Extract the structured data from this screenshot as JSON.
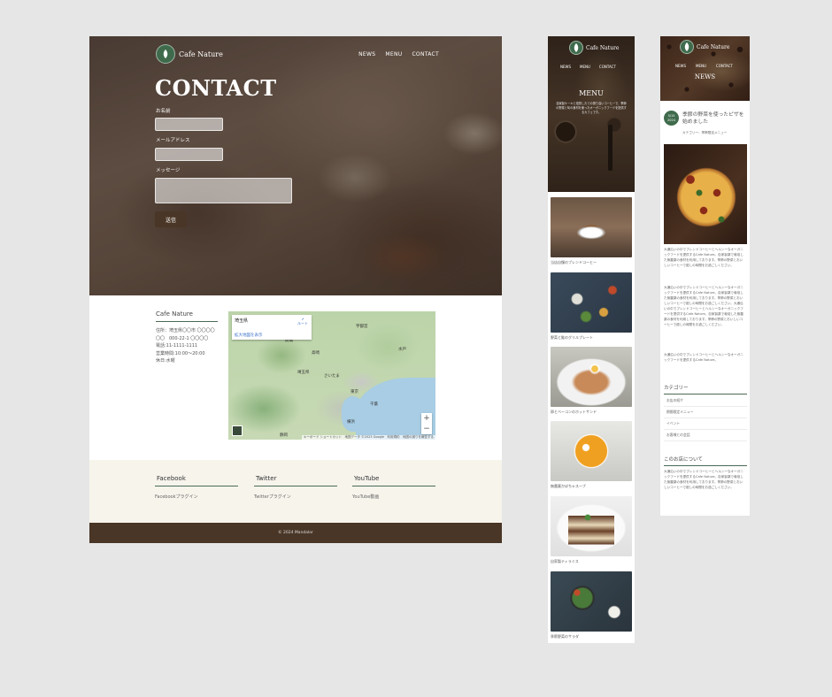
{
  "brand": {
    "name": "Cafe Nature"
  },
  "nav": [
    "NEWS",
    "MENU",
    "CONTACT"
  ],
  "contact": {
    "title": "CONTACT",
    "name_label": "お名前",
    "email_label": "メールアドレス",
    "message_label": "メッセージ",
    "submit_label": "送信"
  },
  "shop": {
    "heading": "Cafe Nature",
    "address": "住所：埼玉県〇〇市 〇〇〇〇〇〇　000-22-1 〇〇〇〇",
    "phone": "電話:11-1111-1111",
    "hours": "営業時間:10:00～20:00",
    "holiday": "休日:水曜"
  },
  "map": {
    "place": "埼玉県",
    "route_label": "ルート",
    "larger_map_link": "拡大地図を表示",
    "labels": [
      "宇都宮",
      "前橋",
      "高崎",
      "水戸",
      "さいたま",
      "東京",
      "千葉",
      "横浜",
      "静岡",
      "埼玉県"
    ],
    "attribution": "キーボード ショートカット　地図データ ©2023 Google　利用規約　地図の誤りを報告する"
  },
  "footer": {
    "widgets": [
      {
        "title": "Facebook",
        "text": "Facebookプラグイン"
      },
      {
        "title": "Twitter",
        "text": "Twitterプラグイン"
      },
      {
        "title": "YouTube",
        "text": "YouTube動画"
      }
    ],
    "copyright": "© 2024 Mandalor"
  },
  "menu_page": {
    "title": "MENU",
    "description": "自家製ケーキと焙煎したての香り高いコーヒーで、季節の野菜と旬の食材を使ったオーガニックフードを提供するカフェです。",
    "items": [
      {
        "caption": "当店自慢のブレンドコーヒー"
      },
      {
        "caption": "野菜と鮭のグリルプレート"
      },
      {
        "caption": "卵とベーコンのホットサンド"
      },
      {
        "caption": "無農薬かぼちゃスープ"
      },
      {
        "caption": "自家製ティラミス"
      },
      {
        "caption": "季節野菜のサラダ"
      }
    ]
  },
  "news_page": {
    "title": "NEWS",
    "date_day": "5/15",
    "date_year": "2024",
    "article_title": "季節の野菜を使ったピザを始めました",
    "article_category": "カテゴリー：季節限定メニュー",
    "paragraphs": [
      "大通沿いの中でブレンドコーヒーとヘルシーなオーガニックフードを提供するCafe Nature。自家製薬で栽培した無農薬の食材を利用しております。季節の野菜とおいしいコーヒーで癒しの時間をお過ごしください。",
      "大通沿いの中でブレンドコーヒーとヘルシーなオーガニックフードを提供するCafe Nature。自家製薬で栽培した無農薬の食材を利用しております。季節の野菜とおいしいコーヒーで癒しの時間をお過ごしください。大通沿いの中でブレンドコーヒーとヘルシーなオーガニックフードを提供するCafe Nature。自家製薬で栽培した無農薬の食材を利用しております。季節の野菜とおいしいコーヒーで癒しの時間をお過ごしください。",
      "大通沿いの中でブレンドコーヒーとヘルシーなオーガニックフードを提供するCafe Nature。"
    ],
    "category_heading": "カテゴリー",
    "categories": [
      "お店の紹介",
      "期間限定メニュー",
      "イベント",
      "お客様との会話"
    ],
    "about_heading": "このお店について",
    "about_text": "大通沿いの中でブレンドコーヒーとヘルシーなオーガニックフードを提供するCafe Nature。自家製薬で栽培した無農薬の食材を利用しております。季節の野菜とおいしいコーヒーで癒しの時間をお過ごしください。"
  },
  "colors": {
    "accent_green": "#3f6b4c",
    "dark_brown": "#4a3626",
    "footer_bg": "#f7f4ec"
  }
}
